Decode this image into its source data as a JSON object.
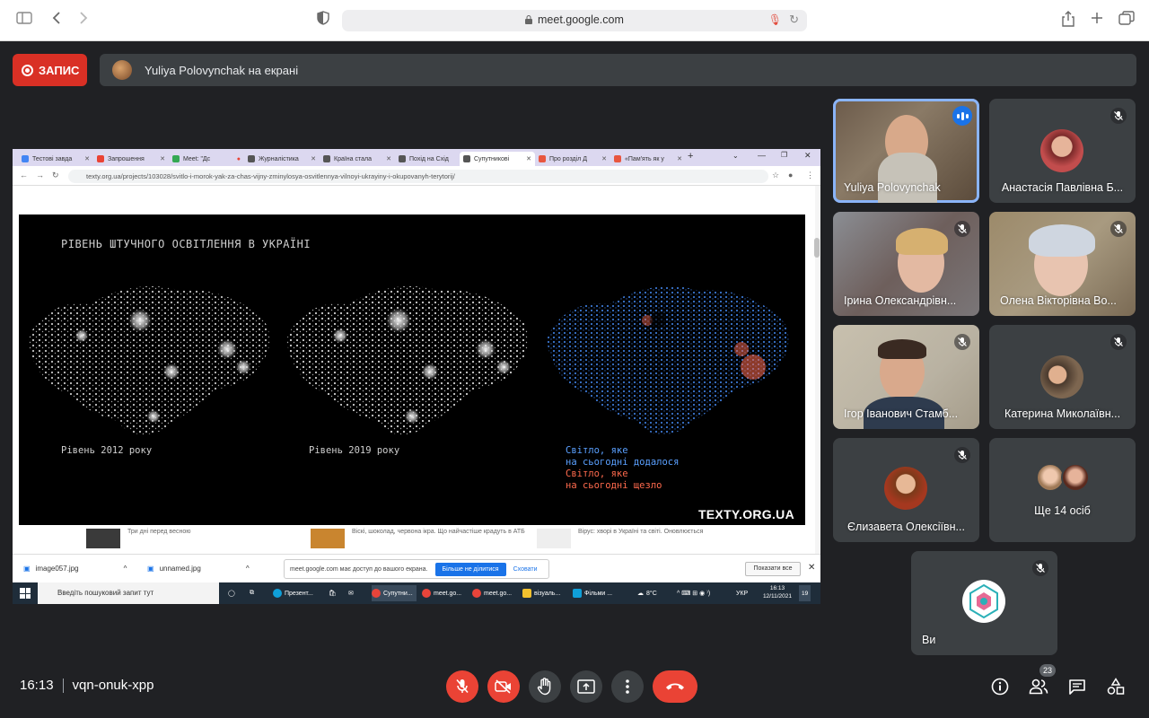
{
  "browser": {
    "url": "meet.google.com"
  },
  "meet": {
    "record_label": "ЗАПИС",
    "presenting_banner": "Yuliya Polovynchak на екрані",
    "time": "16:13",
    "meeting_code": "vqn-onuk-xpp",
    "participant_count": "23"
  },
  "shared_screen": {
    "tabs": [
      {
        "label": "Тестові завда",
        "color": "#4285f4"
      },
      {
        "label": "Запрошення",
        "color": "#ea4335"
      },
      {
        "label": "Meet: \"Дс",
        "color": "#34a853"
      },
      {
        "label": "Журналістика",
        "color": "#555555"
      },
      {
        "label": "Країна стала",
        "color": "#555555"
      },
      {
        "label": "Похід на Схід",
        "color": "#555555"
      },
      {
        "label": "Супутникові",
        "color": "#555555"
      },
      {
        "label": "Про розділ Д",
        "color": "#e8563f"
      },
      {
        "label": "«Пам'ять як у",
        "color": "#e8563f"
      }
    ],
    "address": "texty.org.ua/projects/103028/svitlo-i-morok-yak-za-chas-vijny-zminylosya-osvitlennya-vilnoyi-ukrayiny-i-okupovanyh-terytorij/",
    "map_title": "РІВЕНЬ ШТУЧНОГО ОСВІТЛЕННЯ В УКРАЇНІ",
    "caption_2012": "Рівень 2012 року",
    "caption_2019": "Рівень 2019 року",
    "legend_added_1": "Світло, яке",
    "legend_added_2": "на сьогодні додалося",
    "legend_gone_1": "Світло, яке",
    "legend_gone_2": "на сьогодні щезло",
    "brand": "TEXTY.ORG.UA",
    "news": [
      "Три дні перед весною",
      "Віскі, шоколад, червона ікра. Що найчастіше крадуть в АТБ",
      "Вірус: хворі в Україні та світі. Оновлюється"
    ],
    "downloads": [
      "image057.jpg",
      "unnamed.jpg"
    ],
    "share_notice": "meet.google.com має доступ до вашого екрана.",
    "stop_sharing": "Більше не ділитися",
    "hide": "Сховати",
    "show_all": "Показати все",
    "taskbar_search": "Введіть пошуковий запит тут",
    "taskbar_apps": [
      "Презент...",
      "Супутни...",
      "meet.go...",
      "meet.go...",
      "візуаль...",
      "Фільми ..."
    ],
    "taskbar_temp": "8°C",
    "taskbar_lang": "УКР",
    "taskbar_time": "16:13",
    "taskbar_date": "12/11/2021",
    "taskbar_notif": "19"
  },
  "participants": [
    {
      "name": "Yuliya Polovynchak"
    },
    {
      "name": "Анастасія Павлівна Б..."
    },
    {
      "name": "Ірина Олександрівн..."
    },
    {
      "name": "Олена Вікторівна Во..."
    },
    {
      "name": "Ігор Іванович Стамб..."
    },
    {
      "name": "Катерина Миколаївн..."
    },
    {
      "name": "Єлизавета Олексіївн..."
    },
    {
      "name": "Ще 14 осіб"
    },
    {
      "name": "Ви"
    }
  ]
}
